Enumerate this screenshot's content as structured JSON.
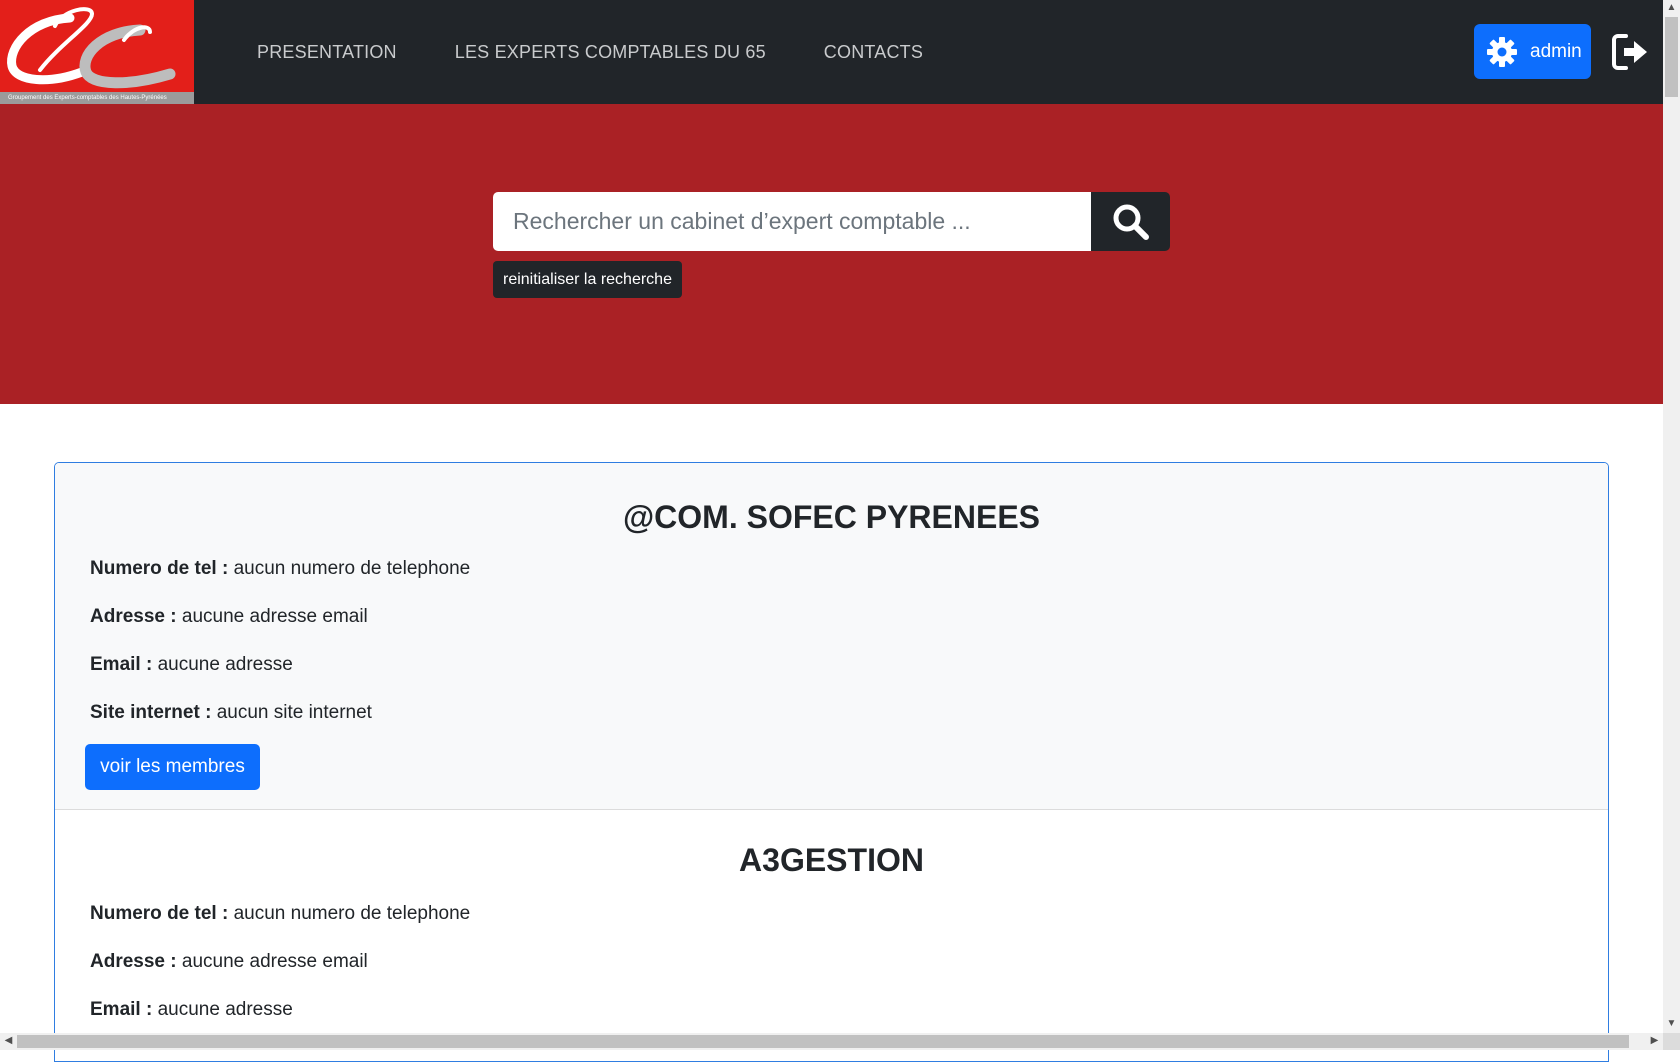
{
  "logo": {
    "caption": "Groupement des Experts-comptables des Hautes-Pyrénées",
    "colors": {
      "red": "#e31f1a",
      "grey": "#9b9b9b"
    }
  },
  "nav": {
    "items": [
      {
        "label": "PRESENTATION"
      },
      {
        "label": "LES EXPERTS COMPTABLES DU 65"
      },
      {
        "label": "CONTACTS"
      }
    ],
    "admin_label": "admin",
    "admin_icon": "gear-icon",
    "logout_icon": "logout-icon"
  },
  "search": {
    "placeholder": "Rechercher un cabinet d’expert comptable ...",
    "value": "",
    "button_icon": "search-icon",
    "reset_label": "reinitialiser la recherche"
  },
  "cabinets": [
    {
      "name": "@COM. SOFEC PYRENEES",
      "tel_label": "Numero de tel :",
      "tel": "aucun numero de telephone",
      "adresse_label": "Adresse :",
      "adresse": "aucune adresse email",
      "email_label": "Email :",
      "email": "aucune adresse",
      "site_label": "Site internet :",
      "site": "aucun site internet",
      "button_label": "voir les membres"
    },
    {
      "name": "A3GESTION",
      "tel_label": "Numero de tel :",
      "tel": "aucun numero de telephone",
      "adresse_label": "Adresse :",
      "adresse": "aucune adresse email",
      "email_label": "Email :",
      "email": "aucune adresse"
    }
  ],
  "colors": {
    "navbar": "#212529",
    "hero": "#aa2125",
    "primary": "#0d6efd",
    "card_border": "#2f7de1"
  }
}
